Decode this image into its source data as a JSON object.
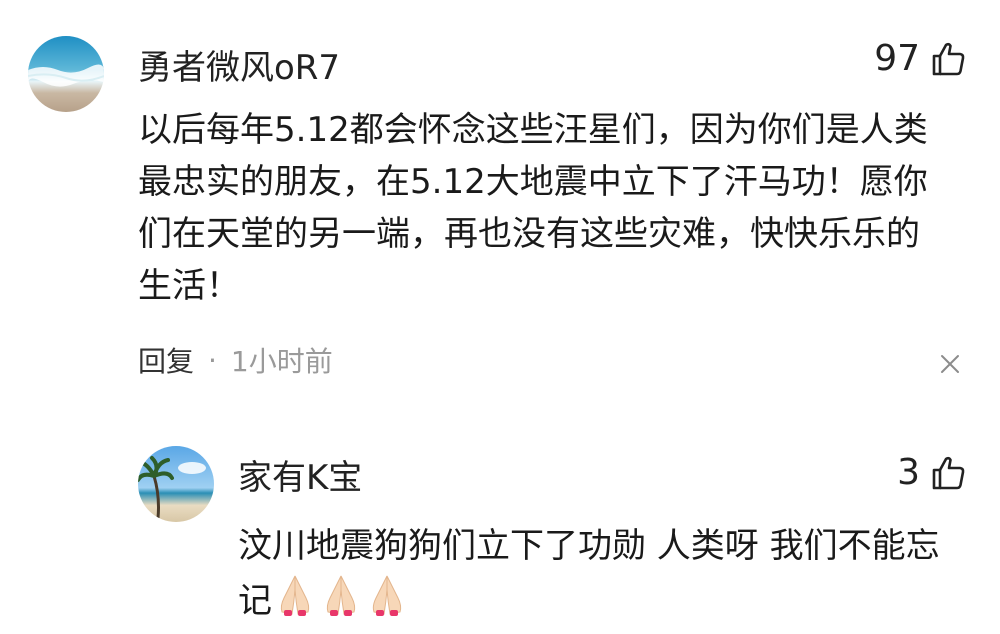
{
  "comments": [
    {
      "username": "勇者微风oR7",
      "likes": "97",
      "text": "以后每年5.12都会怀念这些汪星们，因为你们是人类最忠实的朋友，在5.12大地震中立下了汗马功！愿你们在天堂的另一端，再也没有这些灾难，快快乐乐的生活！",
      "reply_label": "回复",
      "separator": "·",
      "time": "1小时前",
      "avatar_icon": "beach-wave-avatar",
      "close_icon": "close-icon"
    }
  ],
  "replies": [
    {
      "username": "家有K宝",
      "likes": "3",
      "text": "汶川地震狗狗们立下了功勋 人类呀 我们不能忘记",
      "emoji": [
        "folded-hands-icon",
        "folded-hands-icon",
        "folded-hands-icon"
      ],
      "avatar_icon": "palm-tree-avatar"
    }
  ]
}
